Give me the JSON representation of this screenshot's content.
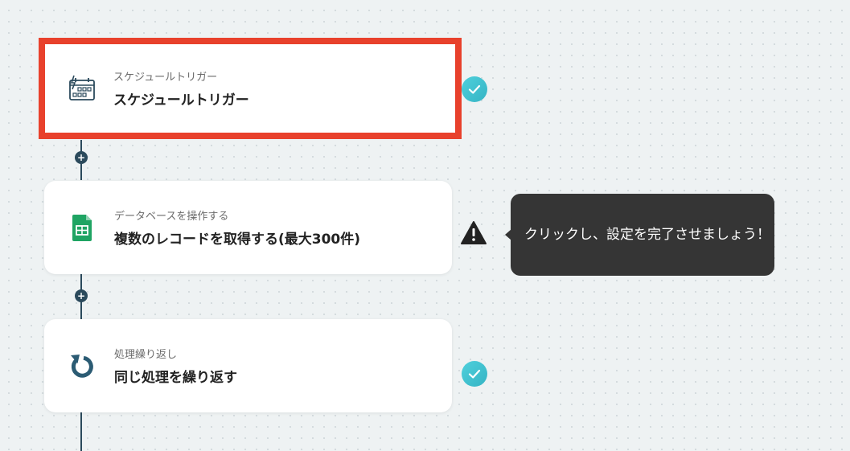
{
  "colors": {
    "accent_highlight": "#e8412c",
    "connector": "#2b4a5c",
    "status_ok": "#45c2cf",
    "tooltip_bg": "#353535",
    "sheets_green": "#1fa463"
  },
  "flow": {
    "steps": [
      {
        "subtitle": "スケジュールトリガー",
        "title": "スケジュールトリガー",
        "icon": "schedule-trigger-icon",
        "status": "complete",
        "highlighted": true
      },
      {
        "subtitle": "データベースを操作する",
        "title": "複数のレコードを取得する(最大300件)",
        "icon": "google-sheets-icon",
        "status": "warning",
        "highlighted": false
      },
      {
        "subtitle": "処理繰り返し",
        "title": "同じ処理を繰り返す",
        "icon": "loop-icon",
        "status": "complete",
        "highlighted": false
      }
    ],
    "add_step_label": "+"
  },
  "tooltip": {
    "text": "クリックし、設定を完了させましょう！"
  }
}
